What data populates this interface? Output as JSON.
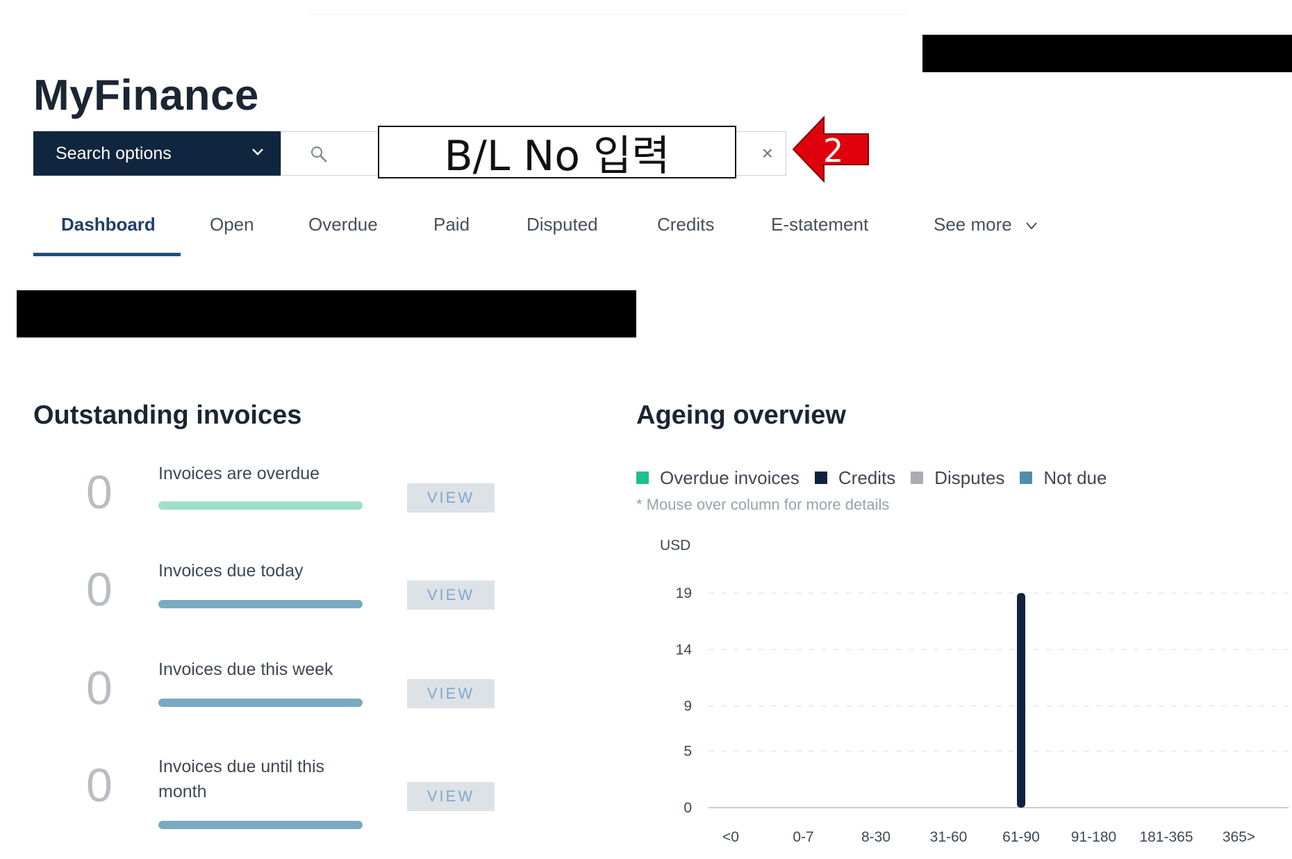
{
  "app": {
    "title": "MyFinance"
  },
  "search": {
    "options_label": "Search options",
    "overlay_text": "B/L No 입력",
    "clear_glyph": "×",
    "callout_number": "2",
    "callout_color": "#e0000b"
  },
  "tabs": [
    {
      "label": "Dashboard",
      "active": true
    },
    {
      "label": "Open"
    },
    {
      "label": "Overdue"
    },
    {
      "label": "Paid"
    },
    {
      "label": "Disputed"
    },
    {
      "label": "Credits"
    },
    {
      "label": "E-statement"
    },
    {
      "label": "See more"
    }
  ],
  "outstanding": {
    "title": "Outstanding invoices",
    "items": [
      {
        "count": "0",
        "label": "Invoices are overdue",
        "bar_color": "#9fe0c8",
        "view": "VIEW"
      },
      {
        "count": "0",
        "label": "Invoices due today",
        "bar_color": "#7aa9c2",
        "view": "VIEW"
      },
      {
        "count": "0",
        "label": "Invoices due this week",
        "bar_color": "#7aa9c2",
        "view": "VIEW"
      },
      {
        "count": "0",
        "label": "Invoices due until this month",
        "bar_color": "#7aa9c2",
        "view": "VIEW"
      }
    ]
  },
  "ageing": {
    "title": "Ageing overview",
    "legend": [
      {
        "label": "Overdue invoices",
        "color": "#1fbf8f"
      },
      {
        "label": "Credits",
        "color": "#0f2340"
      },
      {
        "label": "Disputes",
        "color": "#a8adb3"
      },
      {
        "label": "Not due",
        "color": "#4f8fae"
      }
    ],
    "note": "* Mouse over column for more details",
    "unit": "USD"
  },
  "chart_data": {
    "type": "bar",
    "categories": [
      "<0",
      "0-7",
      "8-30",
      "31-60",
      "61-90",
      "91-180",
      "181-365",
      "365>"
    ],
    "series": [
      {
        "name": "Overdue invoices",
        "values": [
          0,
          0,
          0,
          0,
          0,
          0,
          0,
          0
        ]
      },
      {
        "name": "Credits",
        "values": [
          0,
          0,
          0,
          0,
          19,
          0,
          0,
          0
        ]
      },
      {
        "name": "Disputes",
        "values": [
          0,
          0,
          0,
          0,
          0,
          0,
          0,
          0
        ]
      },
      {
        "name": "Not due",
        "values": [
          0,
          0,
          0,
          0,
          0,
          0,
          0,
          0
        ]
      }
    ],
    "yticks": [
      0,
      5,
      9,
      14,
      19
    ],
    "ylim": [
      0,
      19
    ],
    "ylabel": "USD",
    "grid": true
  }
}
